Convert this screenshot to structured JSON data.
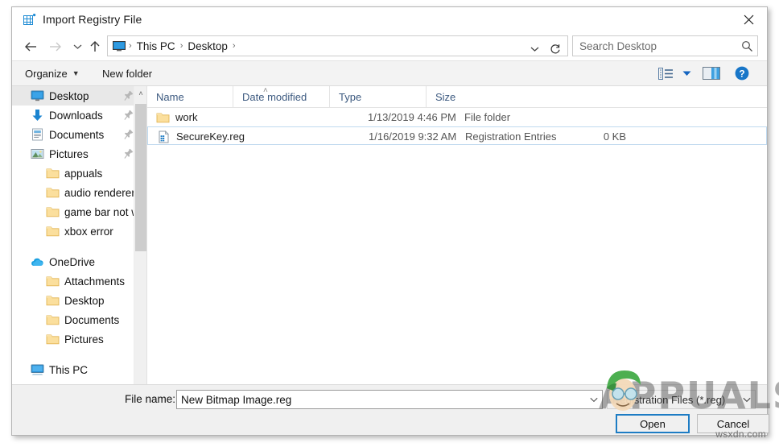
{
  "window": {
    "title": "Import Registry File",
    "title_icon": "registry-grid-icon",
    "close_label": "✕"
  },
  "nav": {
    "back_icon": "←",
    "forward_icon": "→",
    "recent_icon": "⌵",
    "up_icon": "↑",
    "address_icon": "this-pc-monitor-icon",
    "breadcrumbs": [
      "This PC",
      "Desktop"
    ],
    "separator": "›",
    "dropdown_caret": "⌵",
    "refresh_icon": "↻"
  },
  "search": {
    "placeholder": "Search Desktop",
    "value": "",
    "icon": "magnifier-icon"
  },
  "toolbar": {
    "organize_label": "Organize",
    "organize_caret": "▼",
    "new_folder_label": "New folder",
    "views_icon": "view-list-icon",
    "views_caret": "▼",
    "preview_pane_icon": "preview-pane-icon",
    "help_icon": "help-question-icon"
  },
  "sidebar": {
    "scroll": {
      "up_arrow": "˄",
      "down_arrow": "˅"
    },
    "items": [
      {
        "label": "Desktop",
        "icon": "desktop-monitor-icon",
        "level": 0,
        "selected": true,
        "pinned": true
      },
      {
        "label": "Downloads",
        "icon": "download-arrow-icon",
        "level": 0,
        "selected": false,
        "pinned": true
      },
      {
        "label": "Documents",
        "icon": "document-icon",
        "level": 0,
        "selected": false,
        "pinned": true
      },
      {
        "label": "Pictures",
        "icon": "pictures-icon",
        "level": 0,
        "selected": false,
        "pinned": true
      },
      {
        "label": "appuals",
        "icon": "folder-icon",
        "level": 1,
        "selected": false,
        "pinned": false
      },
      {
        "label": "audio renderer e",
        "icon": "folder-icon",
        "level": 1,
        "selected": false,
        "pinned": false
      },
      {
        "label": "game bar not wo",
        "icon": "folder-icon",
        "level": 1,
        "selected": false,
        "pinned": false
      },
      {
        "label": "xbox error",
        "icon": "folder-icon",
        "level": 1,
        "selected": false,
        "pinned": false
      },
      {
        "label": "",
        "icon": "spacer",
        "level": 0,
        "selected": false,
        "pinned": false
      },
      {
        "label": "OneDrive",
        "icon": "onedrive-cloud-icon",
        "level": 0,
        "selected": false,
        "pinned": false
      },
      {
        "label": "Attachments",
        "icon": "folder-icon",
        "level": 1,
        "selected": false,
        "pinned": false
      },
      {
        "label": "Desktop",
        "icon": "folder-icon",
        "level": 1,
        "selected": false,
        "pinned": false
      },
      {
        "label": "Documents",
        "icon": "folder-icon",
        "level": 1,
        "selected": false,
        "pinned": false
      },
      {
        "label": "Pictures",
        "icon": "folder-icon",
        "level": 1,
        "selected": false,
        "pinned": false
      },
      {
        "label": "",
        "icon": "spacer",
        "level": 0,
        "selected": false,
        "pinned": false
      },
      {
        "label": "This PC",
        "icon": "this-pc-icon",
        "level": 0,
        "selected": false,
        "pinned": false
      }
    ]
  },
  "filelist": {
    "columns": [
      {
        "label": "Name",
        "sorted": true
      },
      {
        "label": "Date modified",
        "sorted": false
      },
      {
        "label": "Type",
        "sorted": false
      },
      {
        "label": "Size",
        "sorted": false
      }
    ],
    "sort_caret": "˄",
    "rows": [
      {
        "name": "work",
        "icon": "folder-icon",
        "date": "1/13/2019 4:46 PM",
        "type": "File folder",
        "size": "",
        "selected": false
      },
      {
        "name": "SecureKey.reg",
        "icon": "reg-file-icon",
        "date": "1/16/2019 9:32 AM",
        "type": "Registration Entries",
        "size": "0 KB",
        "selected": true
      }
    ]
  },
  "bottom": {
    "filename_label": "File name:",
    "filename_value": "New Bitmap Image.reg",
    "filename_placeholder": "",
    "filename_caret": "⌵",
    "filetype_value": "Registration Files (*.reg)",
    "filetype_caret": "⌵",
    "open_label": "Open",
    "cancel_label": "Cancel"
  },
  "watermark": {
    "brand": "APPUALS",
    "site": "wsxdn.com"
  },
  "colors": {
    "accent": "#1d7cc4",
    "header_text": "#3d5a80",
    "selection": "#e8e8e8",
    "row_selection_border": "#bfd9ef",
    "chrome": "#f0f0f0"
  }
}
